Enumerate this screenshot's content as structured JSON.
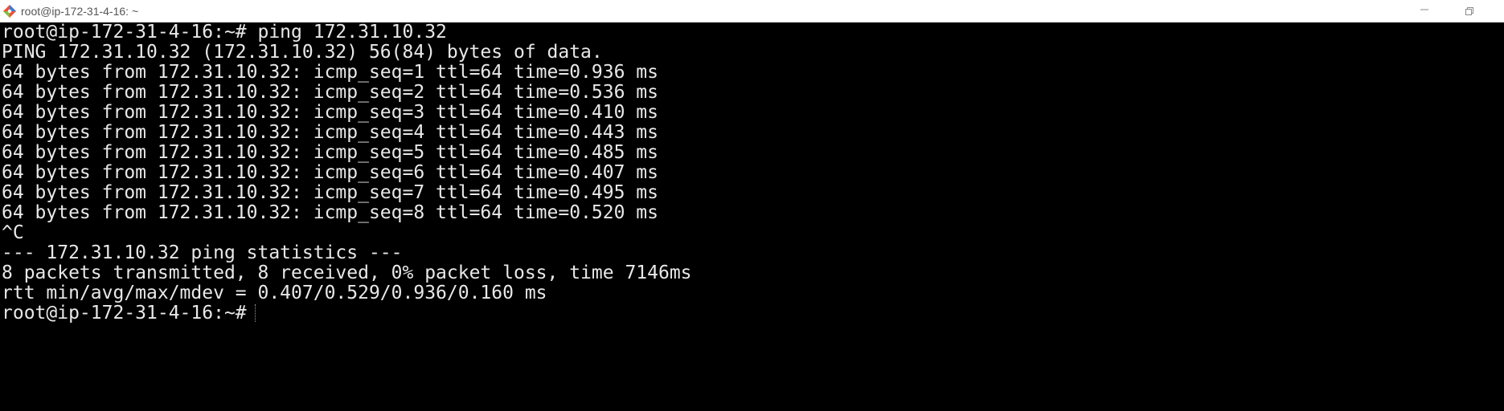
{
  "window": {
    "title": "root@ip-172-31-4-16: ~",
    "icons": {
      "app": "git-bash-diamond-icon",
      "minimize": "minimize-icon",
      "restore": "restore-icon"
    },
    "colors": {
      "terminal_bg": "#000000",
      "terminal_fg": "#e8e8e8",
      "titlebar_bg": "#ffffff"
    }
  },
  "terminal": {
    "lines": [
      "root@ip-172-31-4-16:~# ping 172.31.10.32",
      "PING 172.31.10.32 (172.31.10.32) 56(84) bytes of data.",
      "64 bytes from 172.31.10.32: icmp_seq=1 ttl=64 time=0.936 ms",
      "64 bytes from 172.31.10.32: icmp_seq=2 ttl=64 time=0.536 ms",
      "64 bytes from 172.31.10.32: icmp_seq=3 ttl=64 time=0.410 ms",
      "64 bytes from 172.31.10.32: icmp_seq=4 ttl=64 time=0.443 ms",
      "64 bytes from 172.31.10.32: icmp_seq=5 ttl=64 time=0.485 ms",
      "64 bytes from 172.31.10.32: icmp_seq=6 ttl=64 time=0.407 ms",
      "64 bytes from 172.31.10.32: icmp_seq=7 ttl=64 time=0.495 ms",
      "64 bytes from 172.31.10.32: icmp_seq=8 ttl=64 time=0.520 ms",
      "^C",
      "--- 172.31.10.32 ping statistics ---",
      "8 packets transmitted, 8 received, 0% packet loss, time 7146ms",
      "rtt min/avg/max/mdev = 0.407/0.529/0.936/0.160 ms"
    ],
    "prompt": "root@ip-172-31-4-16:~#"
  }
}
